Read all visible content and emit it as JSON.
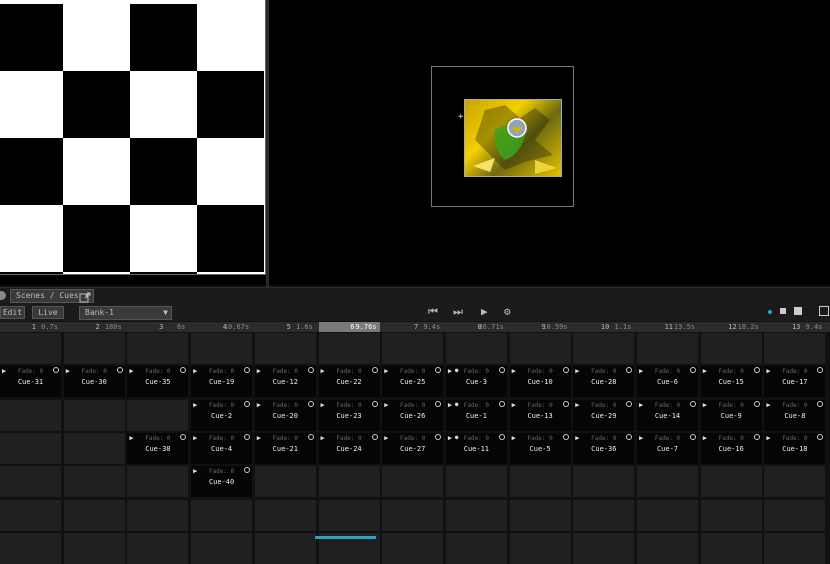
{
  "toolbar": {
    "mode_dropdown": "Scenes / Cues",
    "edit_label": "Edit",
    "live_label": "Live",
    "bank_dropdown": "Bank-1",
    "transport": {
      "prev": "⏮",
      "next": "⏭",
      "play": "▶",
      "settings": "⚙"
    },
    "accent_color": "#2aa4c6"
  },
  "columns": [
    {
      "num": "1",
      "time": "0.7s"
    },
    {
      "num": "2",
      "time": "180s"
    },
    {
      "num": "3",
      "time": "6s"
    },
    {
      "num": "4",
      "time": "10.67s"
    },
    {
      "num": "5",
      "time": "1.6s"
    },
    {
      "num": "6",
      "time": "9.76s"
    },
    {
      "num": "7",
      "time": "9.4s"
    },
    {
      "num": "8",
      "time": "26.71s"
    },
    {
      "num": "9",
      "time": "10.59s"
    },
    {
      "num": "10",
      "time": "1.1s"
    },
    {
      "num": "11",
      "time": "13.5s"
    },
    {
      "num": "12",
      "time": "18.2s"
    },
    {
      "num": "13",
      "time": "9.4s"
    }
  ],
  "active_column": 5,
  "fade_label": "Fade: 0",
  "cues": [
    {
      "row": 1,
      "col": 0,
      "name": "Cue-31"
    },
    {
      "row": 1,
      "col": 1,
      "name": "Cue-30"
    },
    {
      "row": 1,
      "col": 2,
      "name": "Cue-35"
    },
    {
      "row": 1,
      "col": 3,
      "name": "Cue-19"
    },
    {
      "row": 1,
      "col": 4,
      "name": "Cue-12"
    },
    {
      "row": 1,
      "col": 5,
      "name": "Cue-22"
    },
    {
      "row": 1,
      "col": 6,
      "name": "Cue-25"
    },
    {
      "row": 1,
      "col": 7,
      "name": "Cue-3",
      "dot": true
    },
    {
      "row": 1,
      "col": 8,
      "name": "Cue-10"
    },
    {
      "row": 1,
      "col": 9,
      "name": "Cue-28"
    },
    {
      "row": 1,
      "col": 10,
      "name": "Cue-6"
    },
    {
      "row": 1,
      "col": 11,
      "name": "Cue-15"
    },
    {
      "row": 1,
      "col": 12,
      "name": "Cue-17"
    },
    {
      "row": 2,
      "col": 3,
      "name": "Cue-2"
    },
    {
      "row": 2,
      "col": 4,
      "name": "Cue-20"
    },
    {
      "row": 2,
      "col": 5,
      "name": "Cue-23"
    },
    {
      "row": 2,
      "col": 6,
      "name": "Cue-26"
    },
    {
      "row": 2,
      "col": 7,
      "name": "Cue-1",
      "dot": true
    },
    {
      "row": 2,
      "col": 8,
      "name": "Cue-13"
    },
    {
      "row": 2,
      "col": 9,
      "name": "Cue-29"
    },
    {
      "row": 2,
      "col": 10,
      "name": "Cue-14"
    },
    {
      "row": 2,
      "col": 11,
      "name": "Cue-9"
    },
    {
      "row": 2,
      "col": 12,
      "name": "Cue-8"
    },
    {
      "row": 3,
      "col": 2,
      "name": "Cue-38"
    },
    {
      "row": 3,
      "col": 3,
      "name": "Cue-4"
    },
    {
      "row": 3,
      "col": 4,
      "name": "Cue-21"
    },
    {
      "row": 3,
      "col": 5,
      "name": "Cue-24"
    },
    {
      "row": 3,
      "col": 6,
      "name": "Cue-27"
    },
    {
      "row": 3,
      "col": 7,
      "name": "Cue-11",
      "dot": true
    },
    {
      "row": 3,
      "col": 8,
      "name": "Cue-5"
    },
    {
      "row": 3,
      "col": 9,
      "name": "Cue-36"
    },
    {
      "row": 3,
      "col": 10,
      "name": "Cue-7"
    },
    {
      "row": 3,
      "col": 11,
      "name": "Cue-16"
    },
    {
      "row": 3,
      "col": 12,
      "name": "Cue-18"
    },
    {
      "row": 4,
      "col": 3,
      "name": "Cue-40"
    }
  ]
}
